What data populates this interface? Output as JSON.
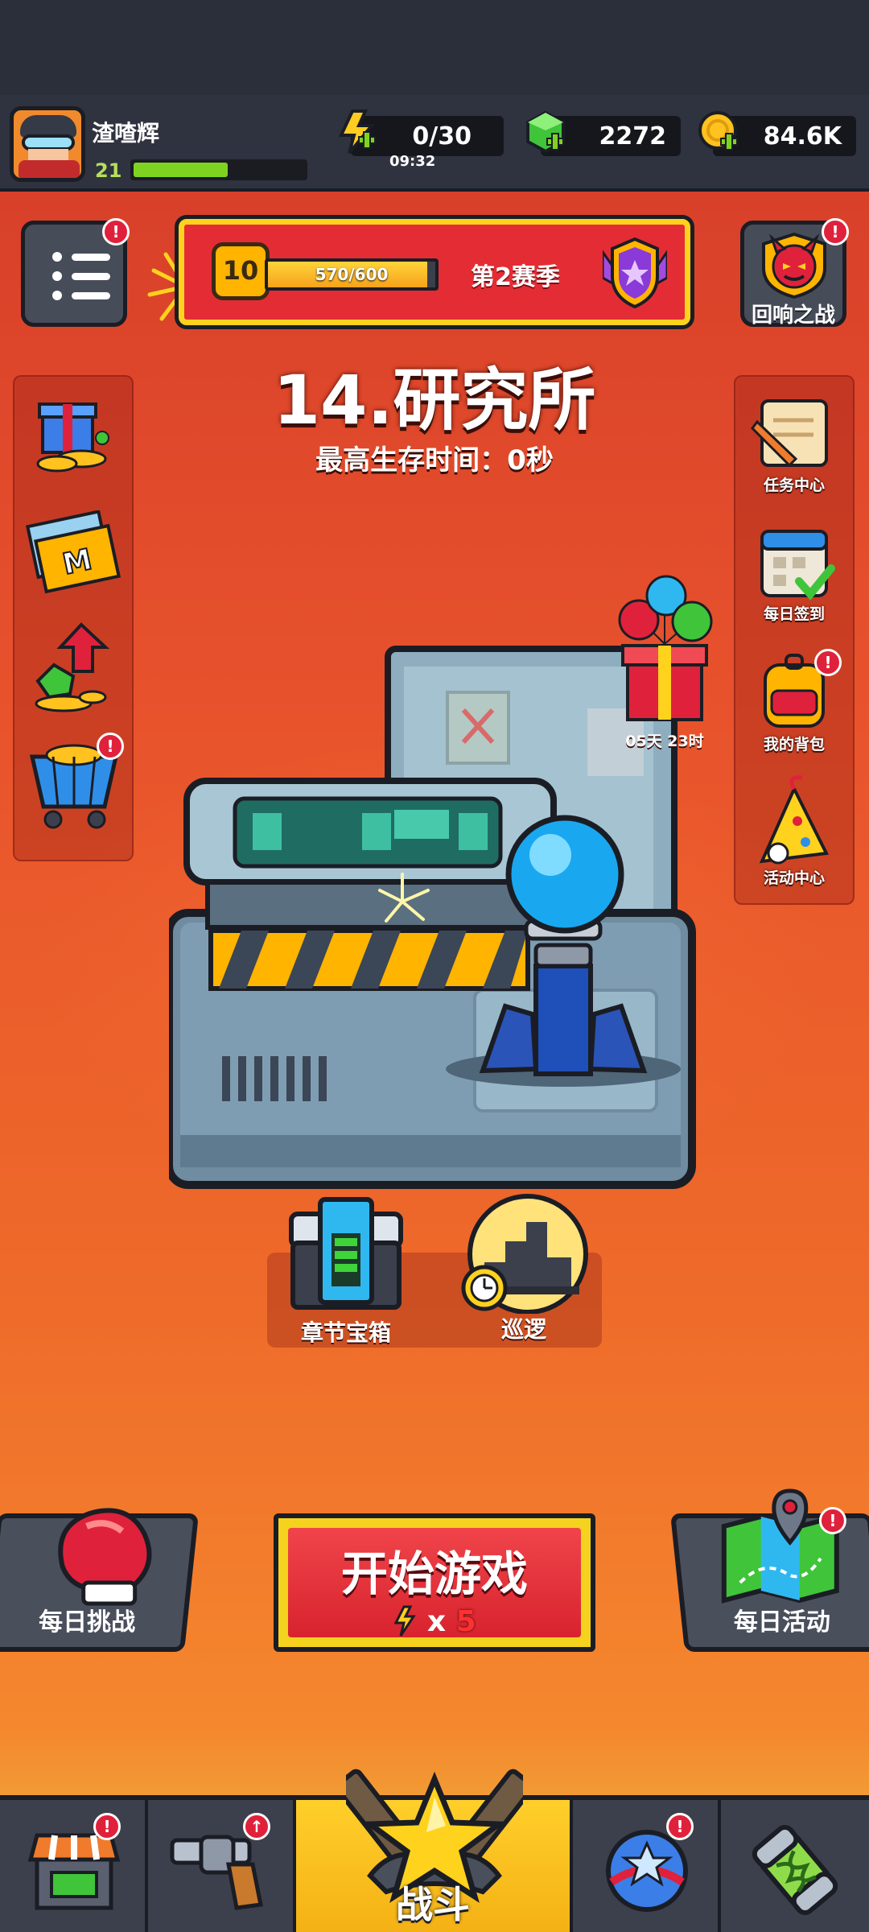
{
  "player": {
    "name": "渣喳辉",
    "level": "21",
    "xp_fraction": 0.55
  },
  "resources": {
    "energy": {
      "value": "0/30",
      "timer": "09:32",
      "icon": "energy-bolt-icon"
    },
    "gems": {
      "value": "2272",
      "icon": "green-gem-icon"
    },
    "coins": {
      "value": "84.6K",
      "icon": "gold-coin-icon"
    }
  },
  "season": {
    "level": "10",
    "progress_text": "570/600",
    "progress": 0.95,
    "title": "第2赛季"
  },
  "echo_battle": {
    "label": "回响之战",
    "badge": "!"
  },
  "menu_badge": "!",
  "stage": {
    "title": "14.研究所",
    "best_survival": "最高生存时间：0秒"
  },
  "left_side": [
    {
      "name": "gift-pack",
      "icon": "gift-coins-icon",
      "badge": ""
    },
    {
      "name": "monthly-card",
      "icon": "m-card-icon",
      "badge": ""
    },
    {
      "name": "growth-fund",
      "icon": "gem-arrow-icon",
      "badge": ""
    },
    {
      "name": "shop-cart",
      "icon": "shopping-cart-icon",
      "badge": "!"
    }
  ],
  "right_side": [
    {
      "label": "任务中心",
      "icon": "scroll-pencil-icon",
      "badge": ""
    },
    {
      "label": "每日签到",
      "icon": "calendar-check-icon",
      "badge": ""
    },
    {
      "label": "我的背包",
      "icon": "backpack-icon",
      "badge": "!"
    },
    {
      "label": "活动中心",
      "icon": "party-horn-icon",
      "badge": ""
    }
  ],
  "balloon_gift": {
    "timer": "05天 23时"
  },
  "chapter_chest": {
    "label": "章节宝箱"
  },
  "patrol": {
    "label": "巡逻"
  },
  "daily_challenge": {
    "label": "每日挑战"
  },
  "daily_event": {
    "label": "每日活动",
    "badge": "!"
  },
  "start_game": {
    "label": "开始游戏",
    "cost_prefix": "x",
    "cost": "5"
  },
  "nav": {
    "shop_badge": "!",
    "weapon_badge": "↑",
    "battle_label": "战斗",
    "talent_badge": "!"
  },
  "colors": {
    "accent_red": "#e42c35",
    "accent_yellow": "#ffd21e",
    "gem_green": "#3fc43a",
    "nav_active": "#ffcf2a"
  }
}
